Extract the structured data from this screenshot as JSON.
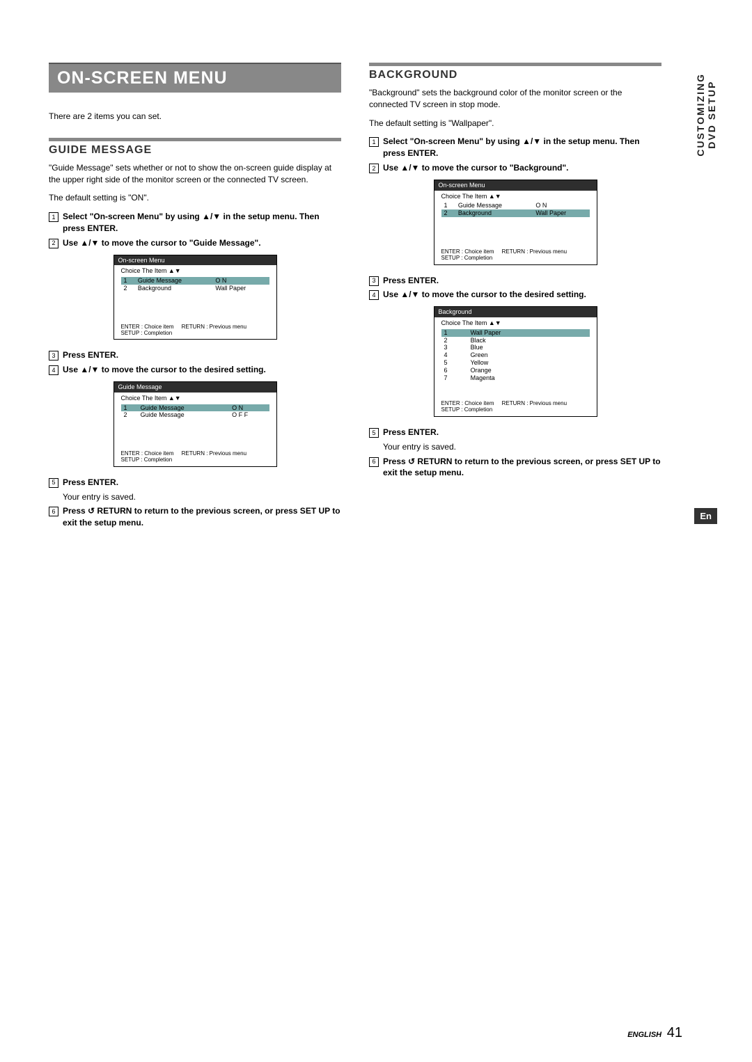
{
  "sideTab": {
    "line1": "CUSTOMIZING",
    "line2": "DVD SETUP"
  },
  "enBadge": "En",
  "footer": {
    "lang": "ENGLISH",
    "page": "41"
  },
  "left": {
    "mainTitle": "ON-SCREEN MENU",
    "intro": "There are 2 items you can set.",
    "section": "GUIDE MESSAGE",
    "desc1": "\"Guide Message\" sets whether or not to show the on-screen guide display at the upper right side of the monitor screen or the connected TV screen.",
    "desc2": "The default setting is \"ON\".",
    "steps1": {
      "s1": "Select \"On-screen Menu\" by using ▲/▼ in the setup menu. Then press ENTER.",
      "s2": "Use ▲/▼ to move the cursor to \"Guide Message\"."
    },
    "osd1": {
      "title": "On-screen Menu",
      "choice": "Choice  The  Item  ▲▼",
      "rows": [
        [
          "1",
          "Guide  Message",
          "O N"
        ],
        [
          "2",
          "Background",
          "Wall  Paper"
        ]
      ],
      "highlightIndex": 0,
      "foot1": "ENTER : Choice  item",
      "foot2": "RETURN : Previous menu",
      "foot3": "SETUP : Completion"
    },
    "steps2": {
      "s3": "Press ENTER.",
      "s4": "Use ▲/▼ to move the cursor to the desired setting."
    },
    "osd2": {
      "title": "Guide  Message",
      "choice": "Choice  The  Item  ▲▼",
      "rows": [
        [
          "1",
          "Guide  Message",
          "O N"
        ],
        [
          "2",
          "Guide  Message",
          "O F F"
        ]
      ],
      "highlightIndex": 0,
      "foot1": "ENTER : Choice  item",
      "foot2": "RETURN : Previous menu",
      "foot3": "SETUP : Completion"
    },
    "steps3": {
      "s5": "Press ENTER.",
      "s5b": "Your entry is saved.",
      "s6": "Press ↺ RETURN to return to the previous screen, or press SET UP to exit the setup menu."
    }
  },
  "right": {
    "section": "BACKGROUND",
    "desc1": "\"Background\" sets the background color of the monitor screen or the connected TV screen in stop mode.",
    "desc2": "The default setting is \"Wallpaper\".",
    "steps1": {
      "s1": "Select \"On-screen Menu\" by using ▲/▼ in the setup menu. Then press ENTER.",
      "s2": "Use ▲/▼ to move the cursor to \"Background\"."
    },
    "osd1": {
      "title": "On-screen Menu",
      "choice": "Choice  The  Item  ▲▼",
      "rows": [
        [
          "1",
          "Guide  Message",
          "O N"
        ],
        [
          "2",
          "Background",
          "Wall  Paper"
        ]
      ],
      "highlightIndex": 1,
      "foot1": "ENTER : Choice  item",
      "foot2": "RETURN : Previous menu",
      "foot3": "SETUP : Completion"
    },
    "steps2": {
      "s3": "Press ENTER.",
      "s4": "Use ▲/▼ to move the cursor to the desired setting."
    },
    "osd2": {
      "title": "Background",
      "choice": "Choice  The  Item  ▲▼",
      "rows": [
        [
          "1",
          "Wall  Paper",
          ""
        ],
        [
          "2",
          "Black",
          ""
        ],
        [
          "3",
          "Blue",
          ""
        ],
        [
          "4",
          "Green",
          ""
        ],
        [
          "5",
          "Yellow",
          ""
        ],
        [
          "6",
          "Orange",
          ""
        ],
        [
          "7",
          "Magenta",
          ""
        ]
      ],
      "highlightIndex": 0,
      "foot1": "ENTER : Choice  item",
      "foot2": "RETURN : Previous menu",
      "foot3": "SETUP : Completion"
    },
    "steps3": {
      "s5": "Press ENTER.",
      "s5b": "Your entry is saved.",
      "s6": "Press ↺ RETURN to return to the previous screen, or press SET UP to exit the setup menu."
    }
  }
}
